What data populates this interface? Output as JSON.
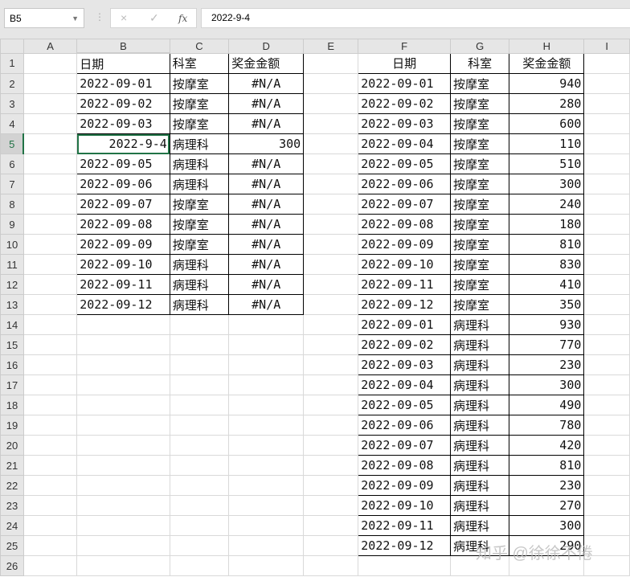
{
  "name_box": "B5",
  "formula_value": "2022-9-4",
  "fx_label": "fx",
  "cancel_icon": "×",
  "enter_icon": "✓",
  "columns": [
    "A",
    "B",
    "C",
    "D",
    "E",
    "F",
    "G",
    "H",
    "I"
  ],
  "left_table": {
    "headers": [
      "日期",
      "科室",
      "奖金金额"
    ],
    "rows": [
      [
        "2022-09-01",
        "按摩室",
        "#N/A"
      ],
      [
        "2022-09-02",
        "按摩室",
        "#N/A"
      ],
      [
        "2022-09-03",
        "按摩室",
        "#N/A"
      ],
      [
        "2022-9-4",
        "病理科",
        "300"
      ],
      [
        "2022-09-05",
        "病理科",
        "#N/A"
      ],
      [
        "2022-09-06",
        "病理科",
        "#N/A"
      ],
      [
        "2022-09-07",
        "按摩室",
        "#N/A"
      ],
      [
        "2022-09-08",
        "按摩室",
        "#N/A"
      ],
      [
        "2022-09-09",
        "按摩室",
        "#N/A"
      ],
      [
        "2022-09-10",
        "病理科",
        "#N/A"
      ],
      [
        "2022-09-11",
        "病理科",
        "#N/A"
      ],
      [
        "2022-09-12",
        "病理科",
        "#N/A"
      ]
    ]
  },
  "right_table": {
    "headers": [
      "日期",
      "科室",
      "奖金金额"
    ],
    "rows": [
      [
        "2022-09-01",
        "按摩室",
        "940"
      ],
      [
        "2022-09-02",
        "按摩室",
        "280"
      ],
      [
        "2022-09-03",
        "按摩室",
        "600"
      ],
      [
        "2022-09-04",
        "按摩室",
        "110"
      ],
      [
        "2022-09-05",
        "按摩室",
        "510"
      ],
      [
        "2022-09-06",
        "按摩室",
        "300"
      ],
      [
        "2022-09-07",
        "按摩室",
        "240"
      ],
      [
        "2022-09-08",
        "按摩室",
        "180"
      ],
      [
        "2022-09-09",
        "按摩室",
        "810"
      ],
      [
        "2022-09-10",
        "按摩室",
        "830"
      ],
      [
        "2022-09-11",
        "按摩室",
        "410"
      ],
      [
        "2022-09-12",
        "按摩室",
        "350"
      ],
      [
        "2022-09-01",
        "病理科",
        "930"
      ],
      [
        "2022-09-02",
        "病理科",
        "770"
      ],
      [
        "2022-09-03",
        "病理科",
        "230"
      ],
      [
        "2022-09-04",
        "病理科",
        "300"
      ],
      [
        "2022-09-05",
        "病理科",
        "490"
      ],
      [
        "2022-09-06",
        "病理科",
        "780"
      ],
      [
        "2022-09-07",
        "病理科",
        "420"
      ],
      [
        "2022-09-08",
        "病理科",
        "810"
      ],
      [
        "2022-09-09",
        "病理科",
        "230"
      ],
      [
        "2022-09-10",
        "病理科",
        "270"
      ],
      [
        "2022-09-11",
        "病理科",
        "300"
      ],
      [
        "2022-09-12",
        "病理科",
        "290"
      ]
    ]
  },
  "row_count": 26,
  "watermark": "知乎 @徐徐不倦"
}
